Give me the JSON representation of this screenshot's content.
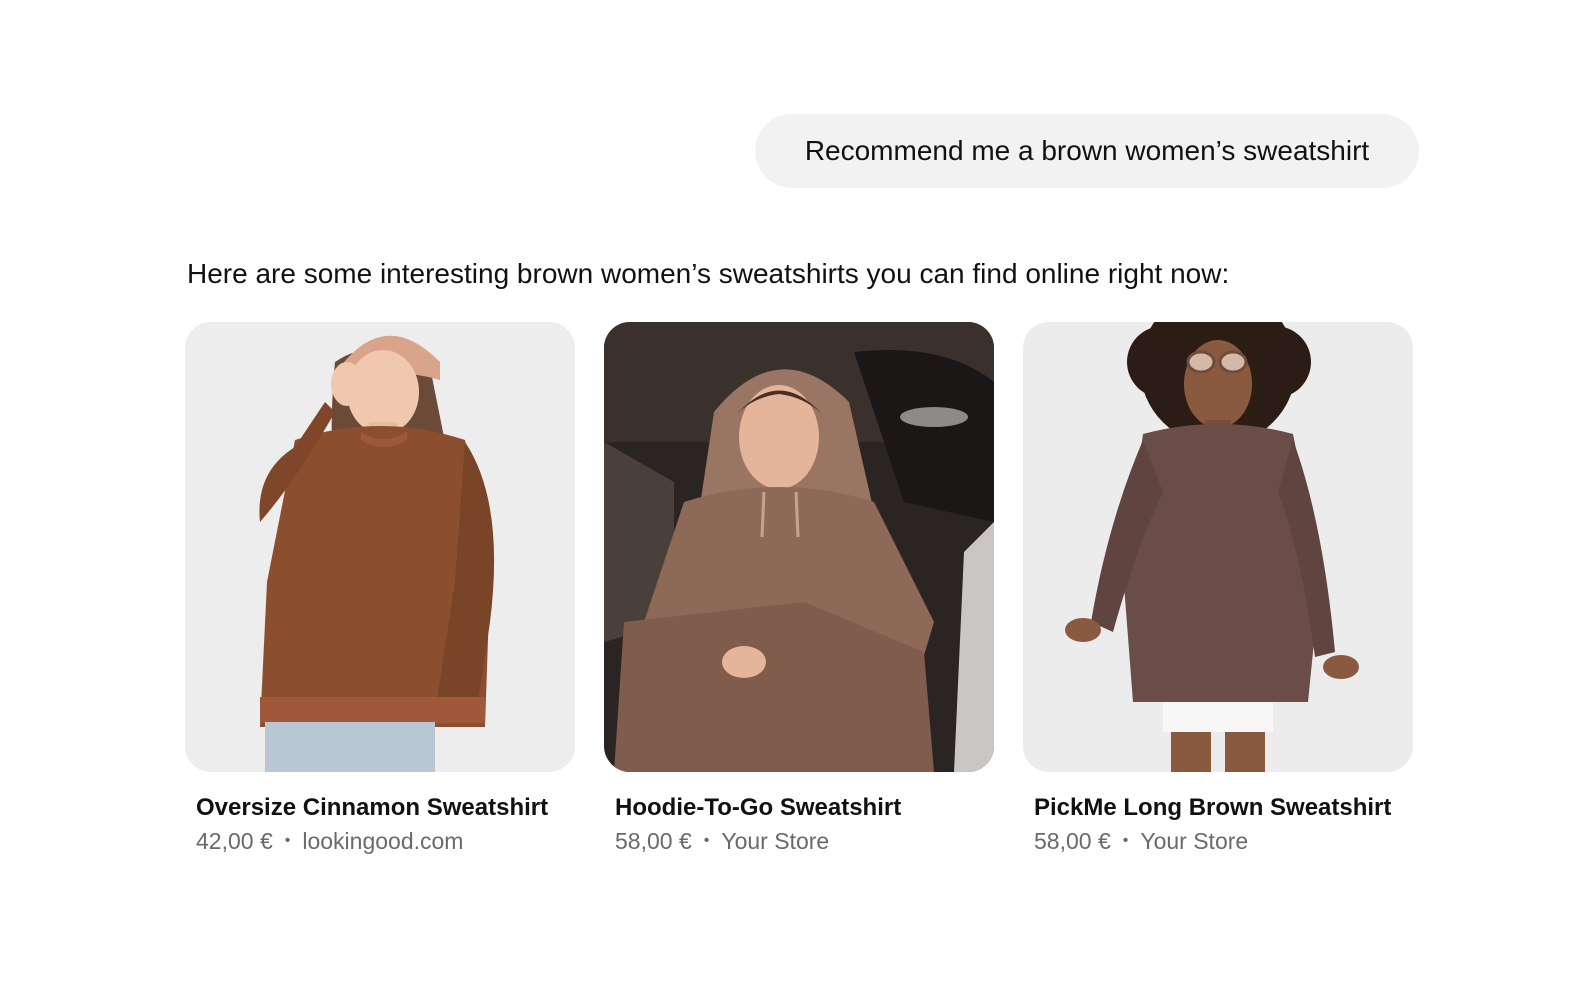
{
  "chat": {
    "user_message": "Recommend me a brown women’s sweatshirt",
    "assistant_message": "Here are some interesting brown women’s sweatshirts you can find online right now:"
  },
  "products": [
    {
      "title": "Oversize Cinnamon Sweatshirt",
      "price": "42,00 €",
      "separator": "•",
      "store": "lookingood.com",
      "image_icon": "woman-in-beanie-sweatshirt-photo",
      "sweatshirt_color": "#8b4f2f"
    },
    {
      "title": "Hoodie-To-Go Sweatshirt",
      "price": "58,00 €",
      "separator": "•",
      "store": "Your Store",
      "image_icon": "woman-in-car-hoodie-photo",
      "sweatshirt_color": "#9b7563"
    },
    {
      "title": "PickMe Long Brown Sweatshirt",
      "price": "58,00 €",
      "separator": "•",
      "store": "Your Store",
      "image_icon": "woman-with-sunglasses-sweatshirt-photo",
      "sweatshirt_color": "#6a4d48"
    }
  ],
  "colors": {
    "user_bubble_bg": "#f2f2f2",
    "text_primary": "#111111",
    "text_secondary": "#6a6a6a"
  }
}
